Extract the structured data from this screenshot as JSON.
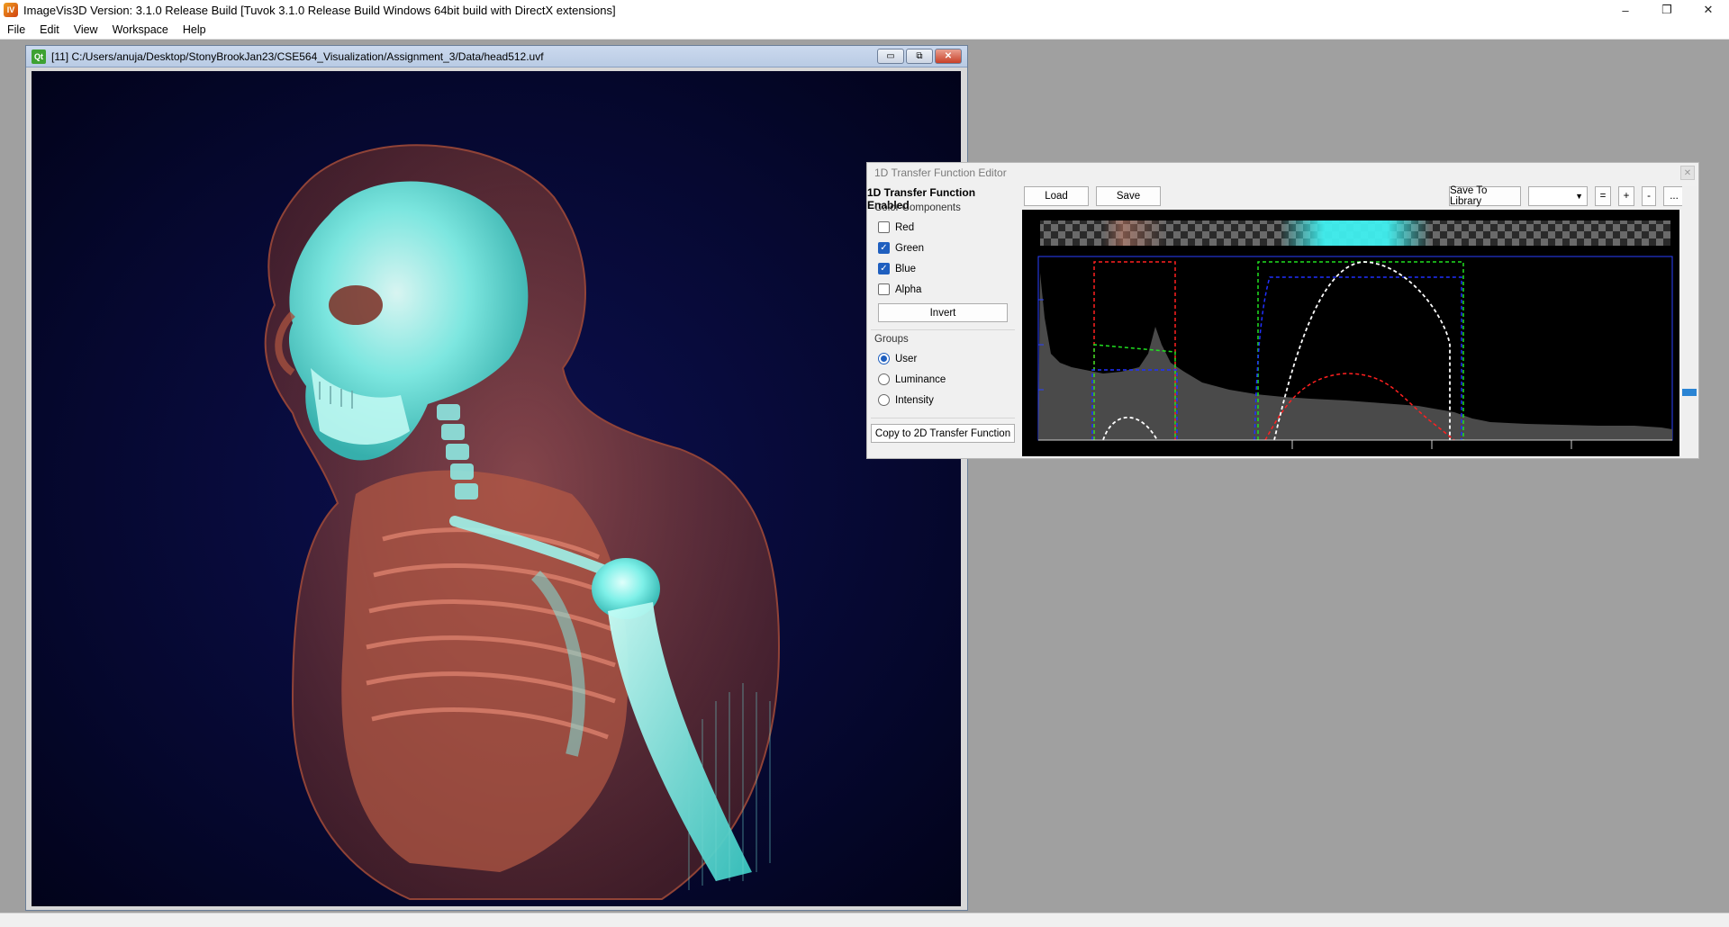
{
  "titlebar": {
    "title": "ImageVis3D Version: 3.1.0 Release Build [Tuvok 3.1.0 Release Build Windows 64bit build with DirectX extensions]",
    "app_icon": "imagevis3d-icon",
    "minimize": "–",
    "maximize": "❐",
    "close": "✕"
  },
  "menu": {
    "items": [
      "File",
      "Edit",
      "View",
      "Workspace",
      "Help"
    ]
  },
  "render_window": {
    "title": "[11] C:/Users/anuja/Desktop/StonyBrookJan23/CSE564_Visualization/Assignment_3/Data/head512.uvf",
    "qt_icon": "Qt"
  },
  "tf_editor": {
    "title": "1D Transfer Function Editor",
    "enabled_label": "1D Transfer Function Enabled",
    "color_components_title": "Color Components",
    "components": [
      {
        "label": "Red",
        "checked": false
      },
      {
        "label": "Green",
        "checked": true
      },
      {
        "label": "Blue",
        "checked": true
      },
      {
        "label": "Alpha",
        "checked": false
      }
    ],
    "invert_label": "Invert",
    "groups_title": "Groups",
    "groups": [
      {
        "label": "User",
        "checked": true
      },
      {
        "label": "Luminance",
        "checked": false
      },
      {
        "label": "Intensity",
        "checked": false
      }
    ],
    "copy_label": "Copy to 2D Transfer Function",
    "load_label": "Load",
    "save_label": "Save",
    "save_library_label": "Save To Library",
    "eq_label": "=",
    "plus_label": "+",
    "minus_label": "-",
    "more_label": "...",
    "colors": {
      "red_curve": "#ff2020",
      "green_curve": "#20e020",
      "blue_curve": "#2030ff",
      "alpha_curve": "#ffffff",
      "histogram": "#444444",
      "bar_cyan": "#40f0f0",
      "bar_salmon": "#e08a70"
    }
  }
}
